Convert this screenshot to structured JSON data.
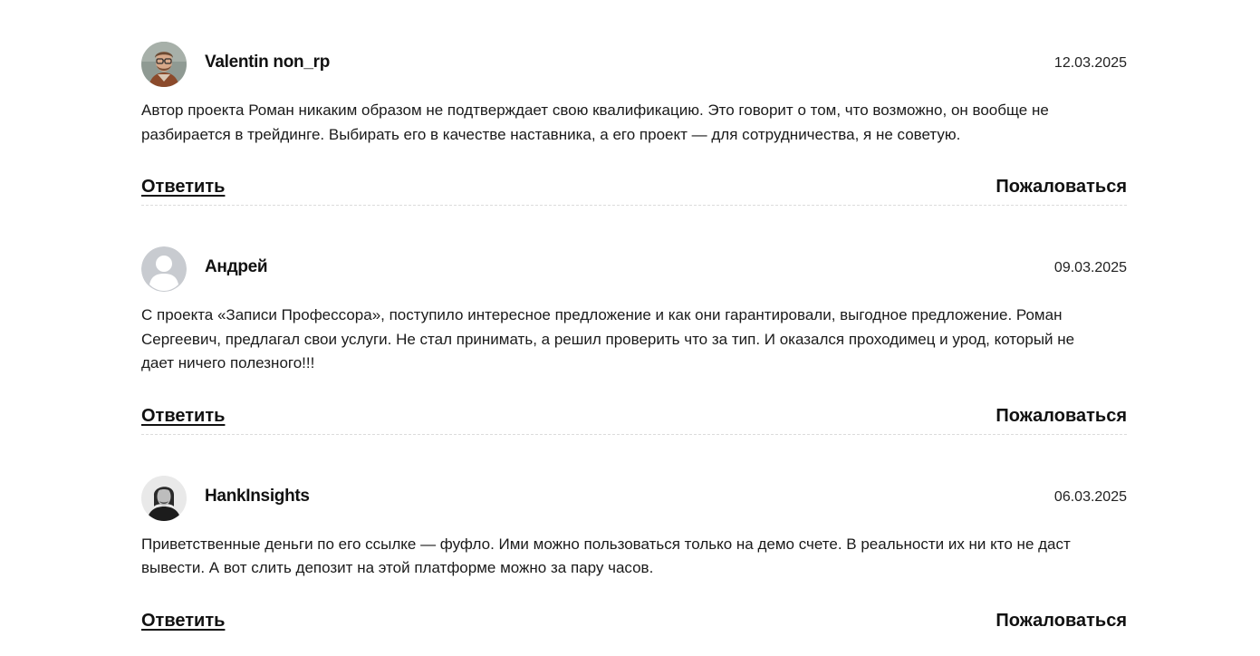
{
  "comments": [
    {
      "author": "Valentin non_rp",
      "date": "12.03.2025",
      "avatar": "photo-avatar",
      "text": "Автор проекта Роман никаким образом не подтверждает свою квалификацию. Это говорит о том, что возможно, он вообще не разбирается в трейдинге. Выбирать его в качестве наставника, а его проект — для сотрудничества, я не советую.",
      "reply_label": "Ответить",
      "report_label": "Пожаловаться"
    },
    {
      "author": "Андрей",
      "date": "09.03.2025",
      "avatar": "default-user-avatar",
      "text": "С проекта «Записи Профессора», поступило интересное предложение и как они гарантировали, выгодное предложение. Роман Сергеевич, предлагал свои услуги. Не стал принимать, а решил проверить что за тип. И оказался проходимец и урод, который не дает ничего полезного!!!",
      "reply_label": "Ответить",
      "report_label": "Пожаловаться"
    },
    {
      "author": "HankInsights",
      "date": "06.03.2025",
      "avatar": "photo-avatar",
      "text": "Приветственные деньги по его ссылке — фуфло. Ими можно пользоваться только на демо счете. В реальности их ни кто не даст вывести. А вот слить депозит на этой платформе можно за пару часов.",
      "reply_label": "Ответить",
      "report_label": "Пожаловаться"
    }
  ]
}
